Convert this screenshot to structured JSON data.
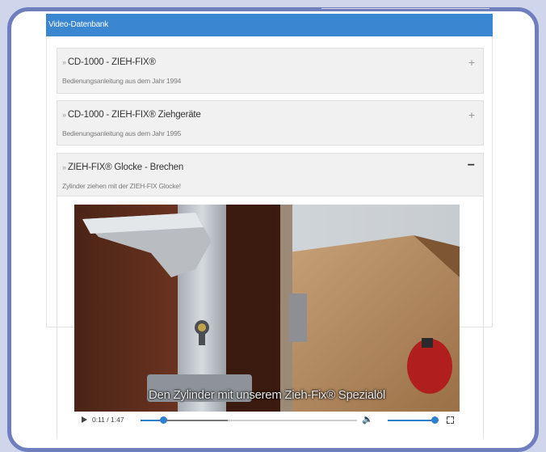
{
  "header": {
    "title": "Video-Datenbank"
  },
  "items": [
    {
      "title": "CD-1000 - ZIEH-FIX®",
      "subtitle": "Bedienungsanleitung aus dem Jahr 1994",
      "toggle": "+"
    },
    {
      "title": "CD-1000 - ZIEH-FIX® Ziehgeräte",
      "subtitle": "Bedienungsanleitung aus dem Jahr 1995",
      "toggle": "+"
    },
    {
      "title": "ZIEH-FIX® Glocke - Brechen",
      "subtitle": "Zylinder ziehen mit der ZIEH-FIX Glocke!",
      "toggle": "−"
    }
  ],
  "video": {
    "caption": "Den Zylinder mit unserem Zieh-Fix® Spezialöl",
    "time": "0:11 / 1:47",
    "progress_fraction": 0.103,
    "volume_fraction": 1.0
  },
  "icons": {
    "play": "play-icon",
    "volume": "volume-icon",
    "fullscreen": "fullscreen-icon"
  },
  "colors": {
    "header": "#3a86d0",
    "accent": "#2f7fd0",
    "frame": "#6f7fbe",
    "background": "#cfd6ec"
  }
}
